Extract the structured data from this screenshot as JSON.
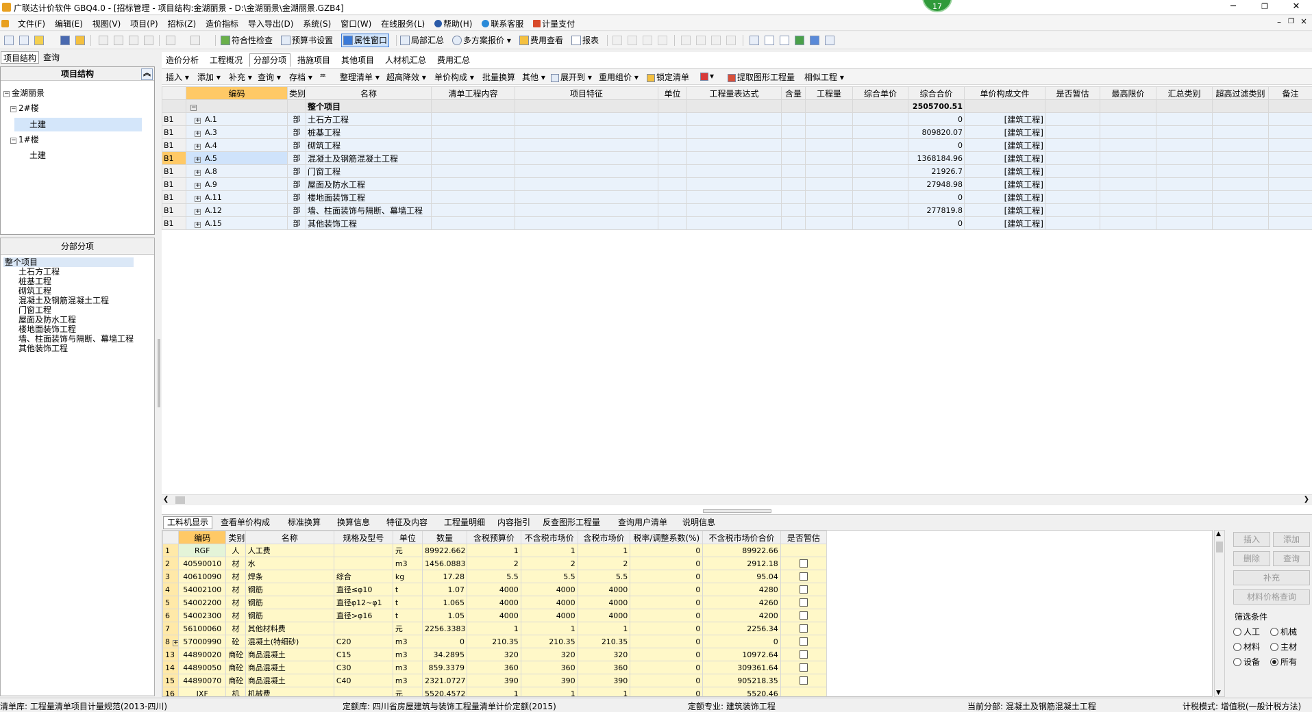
{
  "window": {
    "title": "广联达计价软件 GBQ4.0 - [招标管理 - 项目结构:金湖丽景 - D:\\金湖丽景\\金湖丽景.GZB4]",
    "badge": "17",
    "min": "─",
    "max": "❐",
    "close": "✕",
    "inner_min": "–",
    "inner_max": "❐",
    "inner_close": "×"
  },
  "menu": [
    "文件(F)",
    "编辑(E)",
    "视图(V)",
    "项目(P)",
    "招标(Z)",
    "造价指标",
    "导入导出(D)",
    "系统(S)",
    "窗口(W)",
    "在线服务(L)",
    "帮助(H)",
    "联系客服",
    "计量支付"
  ],
  "toolbar1": {
    "check": "符合性检查",
    "budget": "预算书设置",
    "props": "属性窗口",
    "partial": "局部汇总",
    "multi": "多方案报价",
    "fee": "费用查看",
    "report": "报表"
  },
  "left": {
    "tabs": [
      "项目结构",
      "查询"
    ],
    "tree_header": "项目结构",
    "tree": [
      "金湖丽景",
      "2#楼",
      "土建",
      "1#楼",
      "土建"
    ],
    "sect_header": "分部分项",
    "sections": [
      "整个项目",
      "土石方工程",
      "桩基工程",
      "砌筑工程",
      "混凝土及钢筋混凝土工程",
      "门窗工程",
      "屋面及防水工程",
      "楼地面装饰工程",
      "墙、柱面装饰与隔断、幕墙工程",
      "其他装饰工程"
    ]
  },
  "main": {
    "tabs": [
      "造价分析",
      "工程概况",
      "分部分项",
      "措施项目",
      "其他项目",
      "人材机汇总",
      "费用汇总"
    ],
    "toolbar": [
      "插入 ▾",
      "添加 ▾",
      "补充 ▾",
      "查询 ▾",
      "存档 ▾",
      "整理清单 ▾",
      "超高降效 ▾",
      "单价构成 ▾",
      "批量换算",
      "其他 ▾",
      "展开到 ▾",
      "重用组价 ▾",
      "锁定清单",
      "▾",
      "提取图形工程量",
      "相似工程 ▾"
    ],
    "columns": [
      "编码",
      "类别",
      "名称",
      "清单工程内容",
      "项目特征",
      "单位",
      "工程量表达式",
      "含量",
      "工程量",
      "综合单价",
      "综合合价",
      "单价构成文件",
      "是否暂估",
      "最高限价",
      "汇总类别",
      "超高过滤类别",
      "备注"
    ],
    "total_row": {
      "name": "整个项目",
      "total": "2505700.51",
      "collapse": "−"
    },
    "rows": [
      {
        "rn": "B1",
        "code": "A.1",
        "type": "部",
        "name": "土石方工程",
        "total": "0",
        "file": "[建筑工程]"
      },
      {
        "rn": "B1",
        "code": "A.3",
        "type": "部",
        "name": "桩基工程",
        "total": "809820.07",
        "file": "[建筑工程]"
      },
      {
        "rn": "B1",
        "code": "A.4",
        "type": "部",
        "name": "砌筑工程",
        "total": "0",
        "file": "[建筑工程]"
      },
      {
        "rn": "B1",
        "code": "A.5",
        "type": "部",
        "name": "混凝土及钢筋混凝土工程",
        "total": "1368184.96",
        "file": "[建筑工程]"
      },
      {
        "rn": "B1",
        "code": "A.8",
        "type": "部",
        "name": "门窗工程",
        "total": "21926.7",
        "file": "[建筑工程]"
      },
      {
        "rn": "B1",
        "code": "A.9",
        "type": "部",
        "name": "屋面及防水工程",
        "total": "27948.98",
        "file": "[建筑工程]"
      },
      {
        "rn": "B1",
        "code": "A.11",
        "type": "部",
        "name": "楼地面装饰工程",
        "total": "0",
        "file": "[建筑工程]"
      },
      {
        "rn": "B1",
        "code": "A.12",
        "type": "部",
        "name": "墙、柱面装饰与隔断、幕墙工程",
        "total": "277819.8",
        "file": "[建筑工程]"
      },
      {
        "rn": "B1",
        "code": "A.15",
        "type": "部",
        "name": "其他装饰工程",
        "total": "0",
        "file": "[建筑工程]"
      }
    ]
  },
  "bottom": {
    "tabs": [
      "工料机显示",
      "查看单价构成",
      "标准换算",
      "换算信息",
      "特征及内容",
      "工程量明细",
      "内容指引",
      "反查图形工程量",
      "查询用户清单",
      "说明信息"
    ],
    "columns": [
      "编码",
      "类别",
      "名称",
      "规格及型号",
      "单位",
      "数量",
      "含税预算价",
      "不含税市场价",
      "含税市场价",
      "税率/调整系数(%)",
      "不含税市场价合价",
      "是否暂估"
    ],
    "rows": [
      {
        "n": "1",
        "code": "RGF",
        "type": "人",
        "name": "人工费",
        "spec": "",
        "unit": "元",
        "qty": "89922.662",
        "p1": "1",
        "p2": "1",
        "p3": "1",
        "rate": "0",
        "sum": "89922.66",
        "cb": false
      },
      {
        "n": "2",
        "code": "40590010",
        "type": "材",
        "name": "水",
        "spec": "",
        "unit": "m3",
        "qty": "1456.0883",
        "p1": "2",
        "p2": "2",
        "p3": "2",
        "rate": "0",
        "sum": "2912.18",
        "cb": true
      },
      {
        "n": "3",
        "code": "40610090",
        "type": "材",
        "name": "焊条",
        "spec": "综合",
        "unit": "kg",
        "qty": "17.28",
        "p1": "5.5",
        "p2": "5.5",
        "p3": "5.5",
        "rate": "0",
        "sum": "95.04",
        "cb": true
      },
      {
        "n": "4",
        "code": "54002100",
        "type": "材",
        "name": "钢筋",
        "spec": "直径≤φ10",
        "unit": "t",
        "qty": "1.07",
        "p1": "4000",
        "p2": "4000",
        "p3": "4000",
        "rate": "0",
        "sum": "4280",
        "cb": true
      },
      {
        "n": "5",
        "code": "54002200",
        "type": "材",
        "name": "钢筋",
        "spec": "直径φ12~φ1",
        "unit": "t",
        "qty": "1.065",
        "p1": "4000",
        "p2": "4000",
        "p3": "4000",
        "rate": "0",
        "sum": "4260",
        "cb": true
      },
      {
        "n": "6",
        "code": "54002300",
        "type": "材",
        "name": "钢筋",
        "spec": "直径>φ16",
        "unit": "t",
        "qty": "1.05",
        "p1": "4000",
        "p2": "4000",
        "p3": "4000",
        "rate": "0",
        "sum": "4200",
        "cb": true
      },
      {
        "n": "7",
        "code": "56100060",
        "type": "材",
        "name": "其他材料费",
        "spec": "",
        "unit": "元",
        "qty": "2256.3383",
        "p1": "1",
        "p2": "1",
        "p3": "1",
        "rate": "0",
        "sum": "2256.34",
        "cb": true
      },
      {
        "n": "8",
        "code": "57000990",
        "type": "砼",
        "name": "混凝土(特细砂)",
        "spec": "C20",
        "unit": "m3",
        "qty": "0",
        "p1": "210.35",
        "p2": "210.35",
        "p3": "210.35",
        "rate": "0",
        "sum": "0",
        "cb": true,
        "exp": "+"
      },
      {
        "n": "13",
        "code": "44890020",
        "type": "商砼",
        "name": "商品混凝土",
        "spec": "C15",
        "unit": "m3",
        "qty": "34.2895",
        "p1": "320",
        "p2": "320",
        "p3": "320",
        "rate": "0",
        "sum": "10972.64",
        "cb": true
      },
      {
        "n": "14",
        "code": "44890050",
        "type": "商砼",
        "name": "商品混凝土",
        "spec": "C30",
        "unit": "m3",
        "qty": "859.3379",
        "p1": "360",
        "p2": "360",
        "p3": "360",
        "rate": "0",
        "sum": "309361.64",
        "cb": true
      },
      {
        "n": "15",
        "code": "44890070",
        "type": "商砼",
        "name": "商品混凝土",
        "spec": "C40",
        "unit": "m3",
        "qty": "2321.0727",
        "p1": "390",
        "p2": "390",
        "p3": "390",
        "rate": "0",
        "sum": "905218.35",
        "cb": true
      },
      {
        "n": "16",
        "code": "JXF",
        "type": "机",
        "name": "机械费",
        "spec": "",
        "unit": "元",
        "qty": "5520.4572",
        "p1": "1",
        "p2": "1",
        "p3": "1",
        "rate": "0",
        "sum": "5520.46",
        "cb": false
      }
    ],
    "buttons": {
      "insert": "插入",
      "add": "添加",
      "delete": "删除",
      "query": "查询",
      "supplement": "补充",
      "material_price": "材料价格查询"
    },
    "filter": {
      "title": "筛选条件",
      "options": [
        "人工",
        "机械",
        "材料",
        "主材",
        "设备",
        "所有"
      ],
      "selected": "所有"
    }
  },
  "status": {
    "list_lib": "清单库:  工程量清单项目计量规范(2013-四川)",
    "quota_lib": "定额库:  四川省房屋建筑与装饰工程量清单计价定额(2015)",
    "quota_major": "定额专业:  建筑装饰工程",
    "current_section": "当前分部:  混凝土及钢筋混凝土工程",
    "tax_mode": "计税模式:  增值税(一般计税方法)"
  }
}
